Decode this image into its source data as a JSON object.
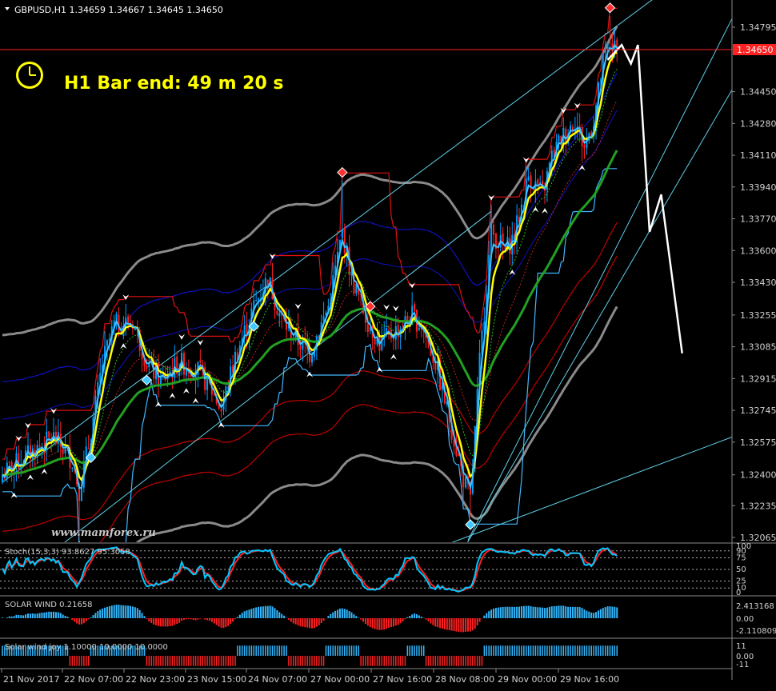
{
  "window": {
    "symbol_line": "GBPUSD,H1  1.34659 1.34667 1.34645 1.34650"
  },
  "timer": {
    "text": "H1 Bar end: 49 m 20 s"
  },
  "watermark": "www.mamforex.ru",
  "price_tag": "1.34650",
  "colors": {
    "background": "#000000",
    "grid": "#3a3a3a",
    "bull": "#00a0ff",
    "bear": "#ff2020",
    "channel": "#5fd0e8",
    "ma_fast": "#ffff00",
    "ma_slow": "#22a022",
    "envelope_gray": "#8a8a8a",
    "envelope_blue": "#1010c0",
    "envelope_red": "#c00000",
    "forecast": "#ffffff",
    "stoch_main": "#00c8ff",
    "stoch_signal": "#ff2020",
    "hist_pos": "#33b8ff",
    "hist_neg": "#ff2020"
  },
  "chart_data": [
    {
      "type": "candlestick",
      "title": "GBPUSD,H1",
      "y_ticks": [
        "1.34795",
        "1.34450",
        "1.34280",
        "1.34110",
        "1.33940",
        "1.33770",
        "1.33600",
        "1.33430",
        "1.33255",
        "1.33085",
        "1.32915",
        "1.32745",
        "1.32575",
        "1.32400",
        "1.32235",
        "1.32065"
      ],
      "ylim": [
        1.32,
        1.349
      ],
      "x_ticks": [
        "21 Nov 2017",
        "22 Nov 07:00",
        "22 Nov 23:00",
        "23 Nov 15:00",
        "24 Nov 07:00",
        "27 Nov 00:00",
        "27 Nov 16:00",
        "28 Nov 08:00",
        "29 Nov 00:00",
        "29 Nov 16:00"
      ],
      "current_price": 1.3465,
      "close_path": [
        [
          0,
          1.324
        ],
        [
          8,
          1.3248
        ],
        [
          16,
          1.3255
        ],
        [
          22,
          1.326
        ],
        [
          30,
          1.3248
        ],
        [
          33,
          1.3232
        ],
        [
          38,
          1.3262
        ],
        [
          43,
          1.33
        ],
        [
          48,
          1.332
        ],
        [
          56,
          1.3322
        ],
        [
          62,
          1.33
        ],
        [
          68,
          1.329
        ],
        [
          76,
          1.33
        ],
        [
          84,
          1.3296
        ],
        [
          90,
          1.3285
        ],
        [
          94,
          1.3275
        ],
        [
          100,
          1.3303
        ],
        [
          108,
          1.333
        ],
        [
          114,
          1.3345
        ],
        [
          120,
          1.3323
        ],
        [
          126,
          1.3313
        ],
        [
          132,
          1.3305
        ],
        [
          140,
          1.333
        ],
        [
          146,
          1.337
        ],
        [
          150,
          1.3345
        ],
        [
          156,
          1.3325
        ],
        [
          162,
          1.331
        ],
        [
          170,
          1.3318
        ],
        [
          176,
          1.3325
        ],
        [
          180,
          1.332
        ],
        [
          186,
          1.33
        ],
        [
          192,
          1.327
        ],
        [
          198,
          1.3238
        ],
        [
          201,
          1.3226
        ],
        [
          205,
          1.33
        ],
        [
          210,
          1.337
        ],
        [
          216,
          1.336
        ],
        [
          220,
          1.3368
        ],
        [
          226,
          1.34
        ],
        [
          232,
          1.339
        ],
        [
          236,
          1.341
        ],
        [
          240,
          1.342
        ],
        [
          246,
          1.343
        ],
        [
          250,
          1.3415
        ],
        [
          254,
          1.343
        ],
        [
          258,
          1.346
        ],
        [
          261,
          1.3472
        ],
        [
          264,
          1.3465
        ]
      ]
    },
    {
      "type": "line",
      "title": "Stoch(15,3,3) 93.8627 95.3058",
      "y_ticks": [
        "100",
        "90",
        "75",
        "50",
        "25",
        "10",
        "0"
      ],
      "ylim": [
        0,
        100
      ]
    },
    {
      "type": "bar",
      "title": "SOLAR WIND 0.21658",
      "y_ticks": [
        "2.413168",
        "0.00",
        "-2.110809"
      ],
      "ylim": [
        -2.110809,
        2.413168
      ]
    },
    {
      "type": "bar",
      "title": "Solar wind joy 1.10000 10.0000 10.0000",
      "y_ticks": [
        "11",
        "0.00",
        "-11"
      ],
      "ylim": [
        -11,
        11
      ]
    }
  ]
}
